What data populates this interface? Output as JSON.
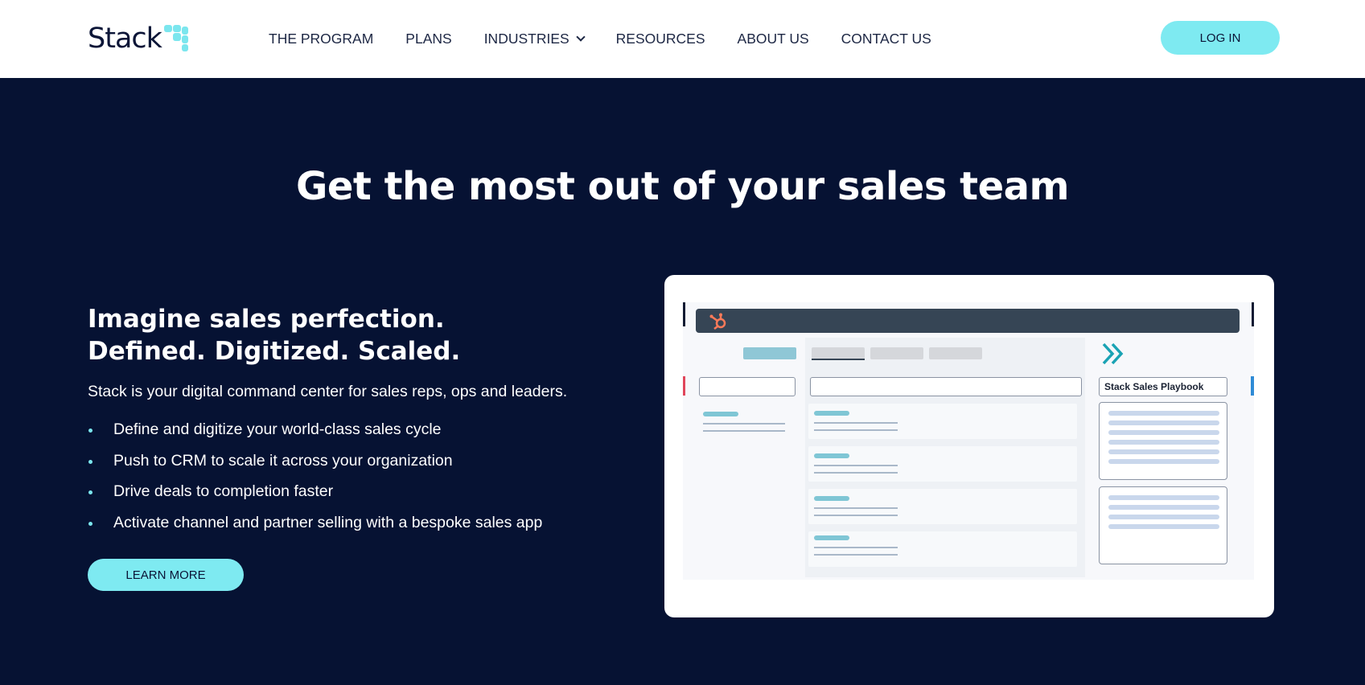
{
  "nav": {
    "logo_text": "Stack",
    "items": [
      {
        "label": "THE PROGRAM"
      },
      {
        "label": "PLANS"
      },
      {
        "label": "INDUSTRIES",
        "has_dropdown": true
      },
      {
        "label": "RESOURCES"
      },
      {
        "label": "ABOUT US"
      },
      {
        "label": "CONTACT US"
      }
    ],
    "login_label": "LOG IN"
  },
  "hero": {
    "title": "Get the most out of your sales team",
    "tagline_line1": "Imagine sales perfection.",
    "tagline_line2": "Defined. Digitized. Scaled.",
    "description": "Stack is your digital command center for sales reps, ops and leaders.",
    "bullets": [
      "Define and digitize your world-class sales cycle",
      "Push to CRM to scale it across your organization",
      "Drive deals to completion faster",
      "Activate channel and partner selling with a bespoke sales app"
    ],
    "cta_label": "LEARN MORE"
  },
  "preview": {
    "playbook_title": "Stack Sales Playbook",
    "icons": [
      "hubspot-icon",
      "double-chevron-right-icon"
    ]
  },
  "colors": {
    "background": "#061233",
    "accent": "#7eeaf1",
    "nav_bg": "#ffffff",
    "text_dark": "#1d2744"
  }
}
